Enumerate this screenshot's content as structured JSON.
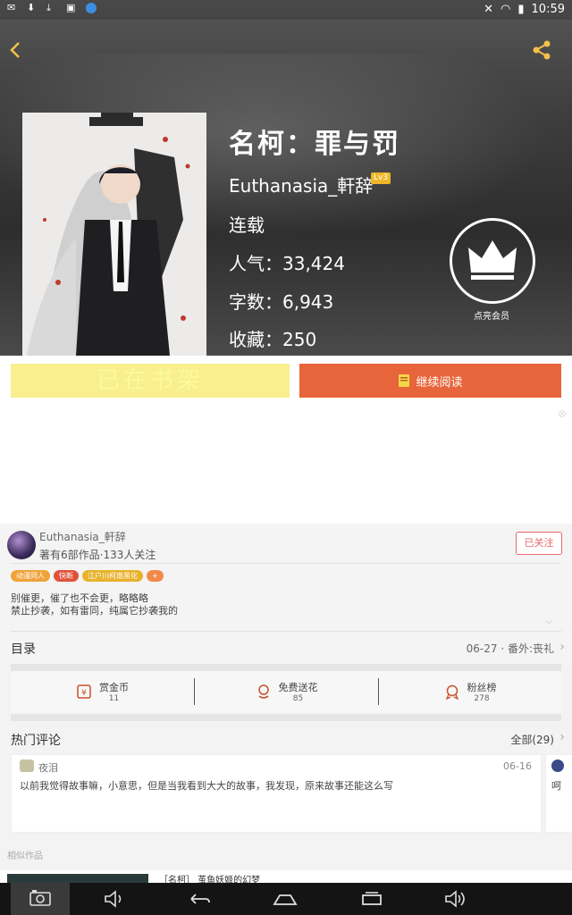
{
  "status_bar": {
    "time": "10:59"
  },
  "header": {
    "back_icon": "back-chevron-icon",
    "share_icon": "share-icon"
  },
  "book": {
    "title": "名柯：罪与罚",
    "author": "Euthanasia_軒辞",
    "level_badge": "Lv3",
    "status": "连载",
    "popularity": "人气：33,424",
    "word_count": "字数：6,943",
    "favorites": "收藏：250"
  },
  "vip": {
    "label": "点亮会员",
    "icon": "crown-icon"
  },
  "actions": {
    "shelf_label": "已在书架",
    "read_label": "继续阅读",
    "read_icon": "book-icon"
  },
  "author_block": {
    "name": "Euthanasia_軒辞",
    "subtitle": "著有6部作品·133人关注",
    "follow_label": "已关注",
    "tags": [
      {
        "label": "动漫同人",
        "color": "#f0a33a"
      },
      {
        "label": "快断",
        "color": "#e0533b"
      },
      {
        "label": "江户川柯南黑化",
        "color": "#e8b22d"
      },
      {
        "label": "+",
        "color": "#f08a4b"
      }
    ],
    "intro_line1": "别催更，催了也不会更，略略略",
    "intro_line2": "禁止抄袭，如有雷同，纯属它抄袭我的"
  },
  "toc": {
    "title": "目录",
    "latest": "06-27 · 番外:丧礼"
  },
  "stats": [
    {
      "label": "赏金币",
      "value": "11",
      "icon": "coin-icon"
    },
    {
      "label": "免费送花",
      "value": "85",
      "icon": "flower-icon"
    },
    {
      "label": "粉丝榜",
      "value": "278",
      "icon": "medal-icon"
    }
  ],
  "comments": {
    "title": "热门评论",
    "all_label": "全部(29)",
    "items": [
      {
        "user": "夜泪",
        "date": "06-16",
        "text": "以前我觉得故事嘛，小意思，但是当我看到大大的故事，我发现，原来故事还能这么写"
      }
    ],
    "partial_text": "呵"
  },
  "similar": {
    "title": "相似作品",
    "first_item": "［名柯］ 茧鱼妖姬的幻梦"
  },
  "nav": {
    "icons": [
      "screenshot-icon",
      "volume-down-icon",
      "back-icon",
      "home-icon",
      "recents-icon",
      "volume-up-icon"
    ]
  },
  "colors": {
    "accent_orange": "#e8643a",
    "shelf_yellow": "#f9ef8e",
    "follow_red": "#e86a6a"
  }
}
